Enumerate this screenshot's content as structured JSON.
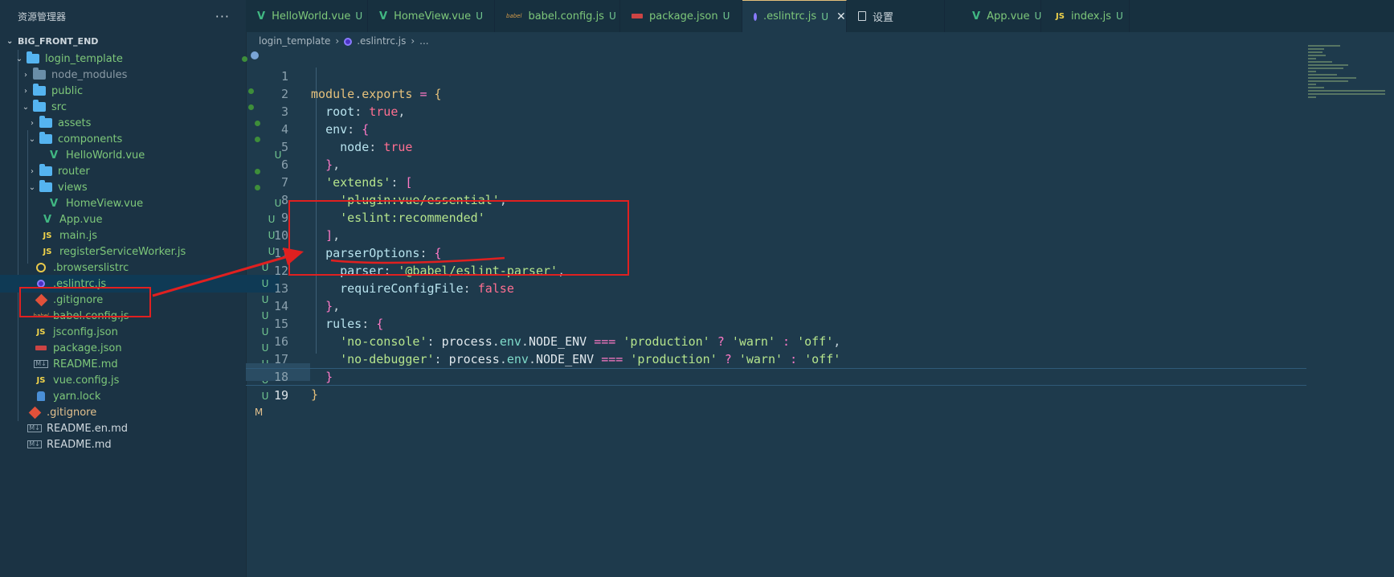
{
  "sidebar": {
    "title": "资源管理器",
    "more": "···",
    "root": "BIG_FRONT_END",
    "items": [
      {
        "label": "login_template",
        "status": "dot"
      },
      {
        "label": "node_modules",
        "status": ""
      },
      {
        "label": "public",
        "status": "dot"
      },
      {
        "label": "src",
        "status": "dot"
      },
      {
        "label": "assets",
        "status": "dot"
      },
      {
        "label": "components",
        "status": "dot"
      },
      {
        "label": "HelloWorld.vue",
        "status": "U"
      },
      {
        "label": "router",
        "status": "dot"
      },
      {
        "label": "views",
        "status": "dot"
      },
      {
        "label": "HomeView.vue",
        "status": "U"
      },
      {
        "label": "App.vue",
        "status": "U"
      },
      {
        "label": "main.js",
        "status": "U"
      },
      {
        "label": "registerServiceWorker.js",
        "status": "U"
      },
      {
        "label": ".browserslistrc",
        "status": "U"
      },
      {
        "label": ".eslintrc.js",
        "status": "U"
      },
      {
        "label": ".gitignore",
        "status": "U"
      },
      {
        "label": "babel.config.js",
        "status": "U"
      },
      {
        "label": "jsconfig.json",
        "status": "U"
      },
      {
        "label": "package.json",
        "status": "U"
      },
      {
        "label": "README.md",
        "status": "U"
      },
      {
        "label": "vue.config.js",
        "status": "U"
      },
      {
        "label": "yarn.lock",
        "status": "U"
      },
      {
        "label": ".gitignore",
        "status": "M"
      },
      {
        "label": "README.en.md",
        "status": ""
      },
      {
        "label": "README.md",
        "status": ""
      }
    ]
  },
  "icons": {
    "js_text": "JS",
    "vue_text": "V",
    "babel_text": "babel",
    "md_text": "M↓",
    "info_icon": "info-icon"
  },
  "tabs": [
    {
      "label": "HelloWorld.vue",
      "status": "U"
    },
    {
      "label": "HomeView.vue",
      "status": "U"
    },
    {
      "label": "babel.config.js",
      "status": "U"
    },
    {
      "label": "package.json",
      "status": "U"
    },
    {
      "label": ".eslintrc.js",
      "status": "U",
      "close": "✕"
    },
    {
      "label": "设置",
      "status": ""
    },
    {
      "label": "App.vue",
      "status": "U"
    },
    {
      "label": "index.js",
      "status": "U"
    }
  ],
  "breadcrumb": {
    "folder": "login_template",
    "sep": "›",
    "file": ".eslintrc.js",
    "tail": "..."
  },
  "editor": {
    "line_numbers": [
      "1",
      "2",
      "3",
      "4",
      "5",
      "6",
      "7",
      "8",
      "9",
      "10",
      "11",
      "12",
      "13",
      "14",
      "15",
      "16",
      "17",
      "18",
      "19"
    ],
    "current_line": "19"
  },
  "colors": {
    "annotation": "#e02020",
    "untracked": "#73c991",
    "modified": "#e2c08d"
  }
}
